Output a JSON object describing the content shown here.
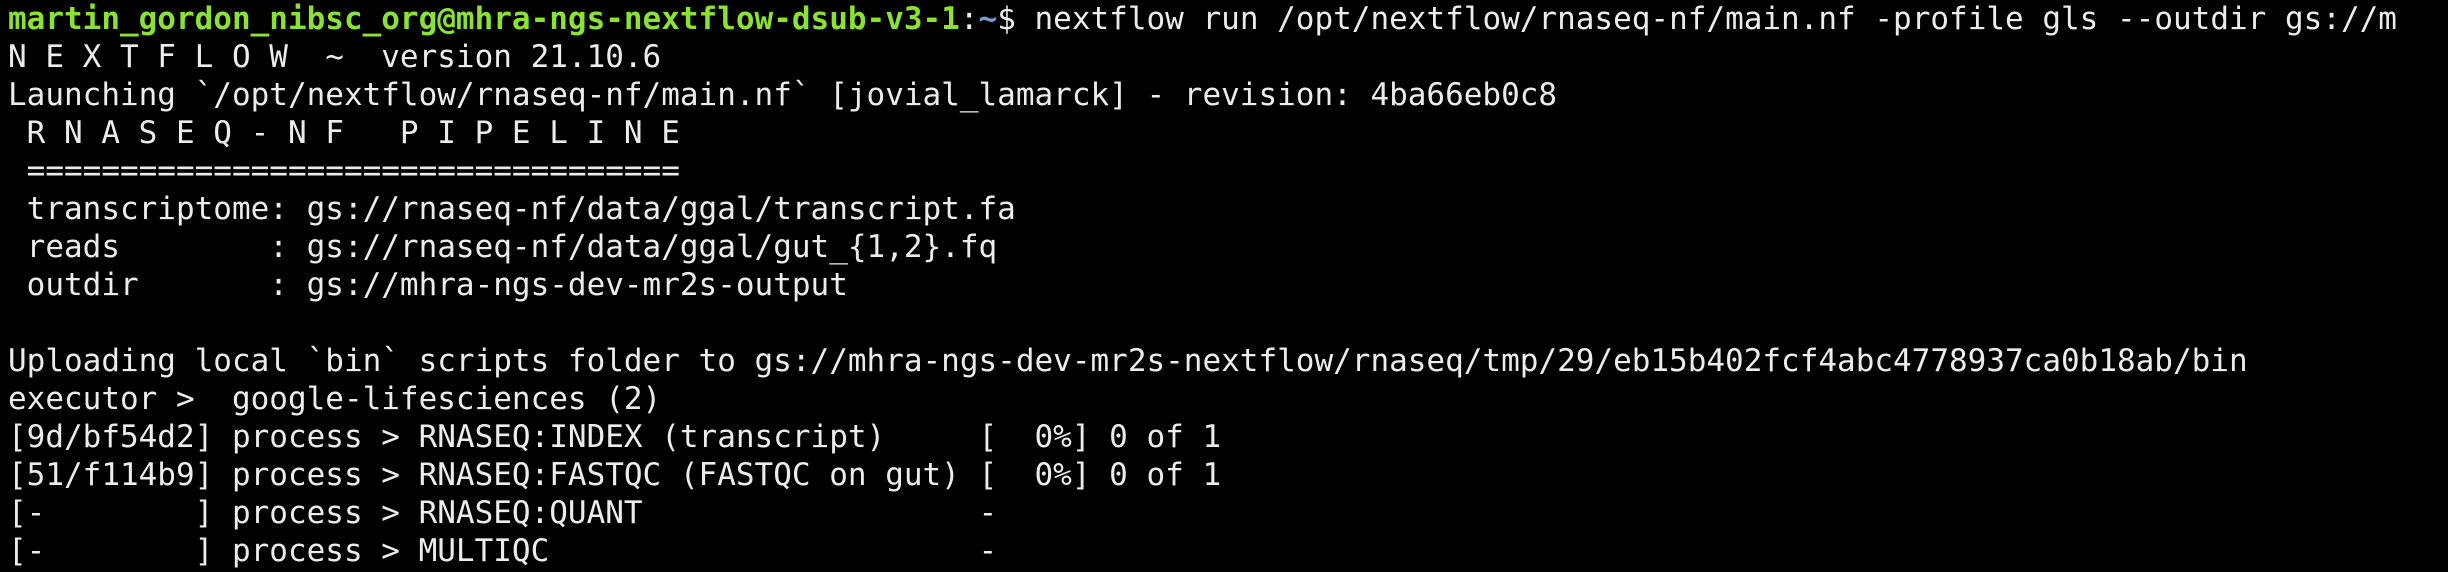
{
  "terminal": {
    "prompt_user": "martin_gordon_nibsc_org@mhra-ngs-nextflow-dsub-v3-1",
    "prompt_sep": ":",
    "prompt_path": "~",
    "prompt_symbol": "$ ",
    "command": "nextflow run /opt/nextflow/rnaseq-nf/main.nf -profile gls --outdir gs://m",
    "lines": [
      "N E X T F L O W  ~  version 21.10.6",
      "Launching `/opt/nextflow/rnaseq-nf/main.nf` [jovial_lamarck] - revision: 4ba66eb0c8",
      " R N A S E Q - N F   P I P E L I N E",
      " ===================================",
      " transcriptome: gs://rnaseq-nf/data/ggal/transcript.fa",
      " reads        : gs://rnaseq-nf/data/ggal/gut_{1,2}.fq",
      " outdir       : gs://mhra-ngs-dev-mr2s-output",
      "",
      "Uploading local `bin` scripts folder to gs://mhra-ngs-dev-mr2s-nextflow/rnaseq/tmp/29/eb15b402fcf4abc4778937ca0b18ab/bin",
      "executor >  google-lifesciences (2)",
      "[9d/bf54d2] process > RNASEQ:INDEX (transcript)     [  0%] 0 of 1",
      "[51/f114b9] process > RNASEQ:FASTQC (FASTQC on gut) [  0%] 0 of 1",
      "[-        ] process > RNASEQ:QUANT                  -",
      "[-        ] process > MULTIQC                       -"
    ]
  },
  "colors": {
    "background": "#000000",
    "text": "#ececec",
    "prompt_user": "#8ae234",
    "prompt_path": "#729fcf"
  }
}
